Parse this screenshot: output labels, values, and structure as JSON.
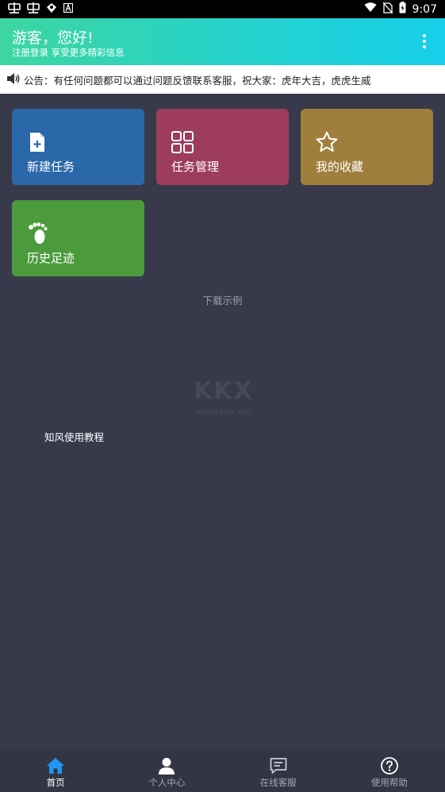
{
  "status_bar": {
    "time": "9:07",
    "left_icons": [
      "notification-app-icon",
      "notification-app-icon",
      "notification-app-icon",
      "notification-app-icon"
    ],
    "right_icons": [
      "wifi-icon",
      "no-sim-icon",
      "battery-charging-icon"
    ]
  },
  "header": {
    "greeting": "游客，您好!",
    "subtitle": "注册登录 享受更多精彩信息",
    "background_gradient": [
      "#3dd6a0",
      "#17cfea"
    ]
  },
  "notice": {
    "text": "公告：有任何问题都可以通过问题反馈联系客服，祝大家：虎年大吉，虎虎生威"
  },
  "cards": [
    {
      "label": "新建任务",
      "icon": "new-file-icon",
      "color": "#2b68a9"
    },
    {
      "label": "任务管理",
      "icon": "grid-icon",
      "color": "#9e3c5d"
    },
    {
      "label": "我的收藏",
      "icon": "star-icon",
      "color": "#a07f3c"
    },
    {
      "label": "历史足迹",
      "icon": "footprint-icon",
      "color": "#4b9b3c"
    }
  ],
  "download_example": "下载示例",
  "watermark": {
    "brand": "KKX",
    "url": "www.kkx.net"
  },
  "tutorial_link": "知风使用教程",
  "bottom_nav": {
    "items": [
      {
        "label": "首页",
        "icon": "home-icon",
        "active": true
      },
      {
        "label": "个人中心",
        "icon": "user-icon",
        "active": false
      },
      {
        "label": "在线客服",
        "icon": "chat-icon",
        "active": false
      },
      {
        "label": "使用帮助",
        "icon": "help-icon",
        "active": false
      }
    ],
    "active_color": "#2196f3"
  }
}
